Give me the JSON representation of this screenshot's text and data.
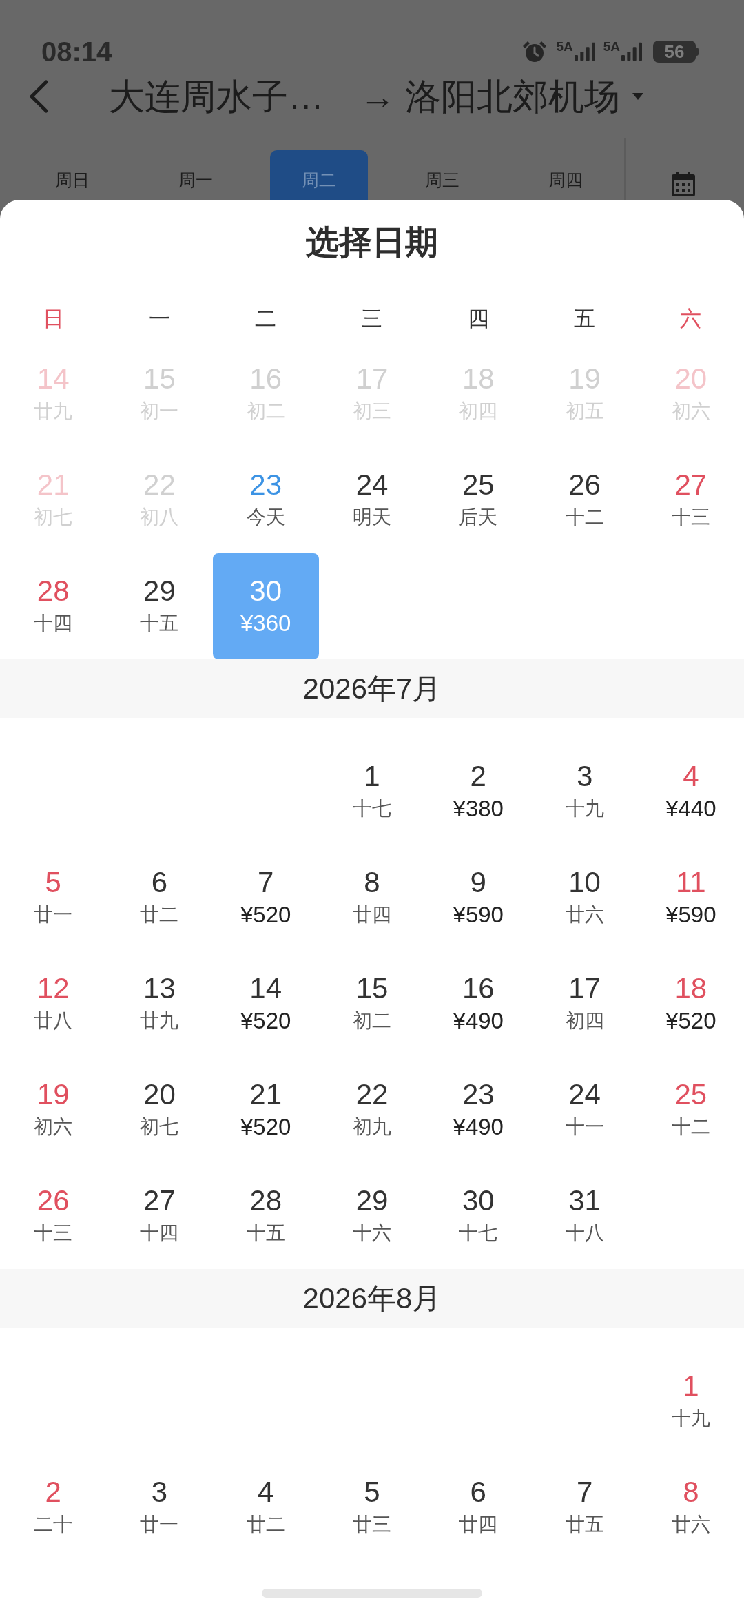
{
  "status_bar": {
    "time": "08:14",
    "signals": [
      {
        "label": "5A"
      },
      {
        "label": "5A"
      }
    ],
    "battery": "56"
  },
  "header": {
    "origin": "大连周水子…",
    "arrow": "→",
    "destination": "洛阳北郊机场"
  },
  "date_tabs": [
    {
      "label": "周日",
      "selected": false
    },
    {
      "label": "周一",
      "selected": false
    },
    {
      "label": "周二",
      "selected": true
    },
    {
      "label": "周三",
      "selected": false
    },
    {
      "label": "周四",
      "selected": false
    }
  ],
  "date_picker": {
    "title": "选择日期",
    "weekdays": [
      {
        "label": "日",
        "weekend": true
      },
      {
        "label": "一",
        "weekend": false
      },
      {
        "label": "二",
        "weekend": false
      },
      {
        "label": "三",
        "weekend": false
      },
      {
        "label": "四",
        "weekend": false
      },
      {
        "label": "五",
        "weekend": false
      },
      {
        "label": "六",
        "weekend": true
      }
    ],
    "months": [
      {
        "weeks": [
          [
            {
              "kind": "date",
              "day": "14",
              "note": "廿九",
              "disabled": true,
              "today": false,
              "selected": false
            },
            {
              "kind": "date",
              "day": "15",
              "note": "初一",
              "disabled": true,
              "today": false,
              "selected": false
            },
            {
              "kind": "date",
              "day": "16",
              "note": "初二",
              "disabled": true,
              "today": false,
              "selected": false
            },
            {
              "kind": "date",
              "day": "17",
              "note": "初三",
              "disabled": true,
              "today": false,
              "selected": false
            },
            {
              "kind": "date",
              "day": "18",
              "note": "初四",
              "disabled": true,
              "today": false,
              "selected": false
            },
            {
              "kind": "date",
              "day": "19",
              "note": "初五",
              "disabled": true,
              "today": false,
              "selected": false
            },
            {
              "kind": "date",
              "day": "20",
              "note": "初六",
              "disabled": true,
              "today": false,
              "selected": false
            }
          ],
          [
            {
              "kind": "date",
              "day": "21",
              "note": "初七",
              "disabled": true,
              "today": false,
              "selected": false
            },
            {
              "kind": "date",
              "day": "22",
              "note": "初八",
              "disabled": true,
              "today": false,
              "selected": false
            },
            {
              "kind": "date",
              "day": "23",
              "note": "今天",
              "disabled": false,
              "today": true,
              "selected": false
            },
            {
              "kind": "date",
              "day": "24",
              "note": "明天",
              "disabled": false,
              "today": false,
              "selected": false
            },
            {
              "kind": "date",
              "day": "25",
              "note": "后天",
              "disabled": false,
              "today": false,
              "selected": false
            },
            {
              "kind": "date",
              "day": "26",
              "note": "十二",
              "disabled": false,
              "today": false,
              "selected": false
            },
            {
              "kind": "date",
              "day": "27",
              "note": "十三",
              "disabled": false,
              "today": false,
              "selected": false
            }
          ],
          [
            {
              "kind": "date",
              "day": "28",
              "note": "十四",
              "disabled": false,
              "today": false,
              "selected": false
            },
            {
              "kind": "date",
              "day": "29",
              "note": "十五",
              "disabled": false,
              "today": false,
              "selected": false
            },
            {
              "kind": "date",
              "day": "30",
              "price": "¥360",
              "disabled": false,
              "today": false,
              "selected": true
            },
            {
              "kind": "blank"
            },
            {
              "kind": "blank"
            },
            {
              "kind": "blank"
            },
            {
              "kind": "blank"
            }
          ]
        ]
      },
      {
        "title": "2026年7月",
        "weeks": [
          [
            {
              "kind": "blank"
            },
            {
              "kind": "blank"
            },
            {
              "kind": "blank"
            },
            {
              "kind": "date",
              "day": "1",
              "note": "十七",
              "disabled": false,
              "today": false,
              "selected": false
            },
            {
              "kind": "date",
              "day": "2",
              "price": "¥380",
              "disabled": false,
              "today": false,
              "selected": false
            },
            {
              "kind": "date",
              "day": "3",
              "note": "十九",
              "disabled": false,
              "today": false,
              "selected": false
            },
            {
              "kind": "date",
              "day": "4",
              "price": "¥440",
              "disabled": false,
              "today": false,
              "selected": false
            }
          ],
          [
            {
              "kind": "date",
              "day": "5",
              "note": "廿一",
              "disabled": false,
              "today": false,
              "selected": false
            },
            {
              "kind": "date",
              "day": "6",
              "note": "廿二",
              "disabled": false,
              "today": false,
              "selected": false
            },
            {
              "kind": "date",
              "day": "7",
              "price": "¥520",
              "disabled": false,
              "today": false,
              "selected": false
            },
            {
              "kind": "date",
              "day": "8",
              "note": "廿四",
              "disabled": false,
              "today": false,
              "selected": false
            },
            {
              "kind": "date",
              "day": "9",
              "price": "¥590",
              "disabled": false,
              "today": false,
              "selected": false
            },
            {
              "kind": "date",
              "day": "10",
              "note": "廿六",
              "disabled": false,
              "today": false,
              "selected": false
            },
            {
              "kind": "date",
              "day": "11",
              "price": "¥590",
              "disabled": false,
              "today": false,
              "selected": false
            }
          ],
          [
            {
              "kind": "date",
              "day": "12",
              "note": "廿八",
              "disabled": false,
              "today": false,
              "selected": false
            },
            {
              "kind": "date",
              "day": "13",
              "note": "廿九",
              "disabled": false,
              "today": false,
              "selected": false
            },
            {
              "kind": "date",
              "day": "14",
              "price": "¥520",
              "disabled": false,
              "today": false,
              "selected": false
            },
            {
              "kind": "date",
              "day": "15",
              "note": "初二",
              "disabled": false,
              "today": false,
              "selected": false
            },
            {
              "kind": "date",
              "day": "16",
              "price": "¥490",
              "disabled": false,
              "today": false,
              "selected": false
            },
            {
              "kind": "date",
              "day": "17",
              "note": "初四",
              "disabled": false,
              "today": false,
              "selected": false
            },
            {
              "kind": "date",
              "day": "18",
              "price": "¥520",
              "disabled": false,
              "today": false,
              "selected": false
            }
          ],
          [
            {
              "kind": "date",
              "day": "19",
              "note": "初六",
              "disabled": false,
              "today": false,
              "selected": false
            },
            {
              "kind": "date",
              "day": "20",
              "note": "初七",
              "disabled": false,
              "today": false,
              "selected": false
            },
            {
              "kind": "date",
              "day": "21",
              "price": "¥520",
              "disabled": false,
              "today": false,
              "selected": false
            },
            {
              "kind": "date",
              "day": "22",
              "note": "初九",
              "disabled": false,
              "today": false,
              "selected": false
            },
            {
              "kind": "date",
              "day": "23",
              "price": "¥490",
              "disabled": false,
              "today": false,
              "selected": false
            },
            {
              "kind": "date",
              "day": "24",
              "note": "十一",
              "disabled": false,
              "today": false,
              "selected": false
            },
            {
              "kind": "date",
              "day": "25",
              "note": "十二",
              "disabled": false,
              "today": false,
              "selected": false
            }
          ],
          [
            {
              "kind": "date",
              "day": "26",
              "note": "十三",
              "disabled": false,
              "today": false,
              "selected": false
            },
            {
              "kind": "date",
              "day": "27",
              "note": "十四",
              "disabled": false,
              "today": false,
              "selected": false
            },
            {
              "kind": "date",
              "day": "28",
              "note": "十五",
              "disabled": false,
              "today": false,
              "selected": false
            },
            {
              "kind": "date",
              "day": "29",
              "note": "十六",
              "disabled": false,
              "today": false,
              "selected": false
            },
            {
              "kind": "date",
              "day": "30",
              "note": "十七",
              "disabled": false,
              "today": false,
              "selected": false
            },
            {
              "kind": "date",
              "day": "31",
              "note": "十八",
              "disabled": false,
              "today": false,
              "selected": false
            },
            {
              "kind": "blank"
            }
          ]
        ]
      },
      {
        "title": "2026年8月",
        "weeks": [
          [
            {
              "kind": "blank"
            },
            {
              "kind": "blank"
            },
            {
              "kind": "blank"
            },
            {
              "kind": "blank"
            },
            {
              "kind": "blank"
            },
            {
              "kind": "blank"
            },
            {
              "kind": "date",
              "day": "1",
              "note": "十九",
              "disabled": false,
              "today": false,
              "selected": false
            }
          ],
          [
            {
              "kind": "date",
              "day": "2",
              "note": "二十",
              "disabled": false,
              "today": false,
              "selected": false
            },
            {
              "kind": "date",
              "day": "3",
              "note": "廿一",
              "disabled": false,
              "today": false,
              "selected": false
            },
            {
              "kind": "date",
              "day": "4",
              "note": "廿二",
              "disabled": false,
              "today": false,
              "selected": false
            },
            {
              "kind": "date",
              "day": "5",
              "note": "廿三",
              "disabled": false,
              "today": false,
              "selected": false
            },
            {
              "kind": "date",
              "day": "6",
              "note": "廿四",
              "disabled": false,
              "today": false,
              "selected": false
            },
            {
              "kind": "date",
              "day": "7",
              "note": "廿五",
              "disabled": false,
              "today": false,
              "selected": false
            },
            {
              "kind": "date",
              "day": "8",
              "note": "廿六",
              "disabled": false,
              "today": false,
              "selected": false
            }
          ]
        ]
      }
    ]
  }
}
